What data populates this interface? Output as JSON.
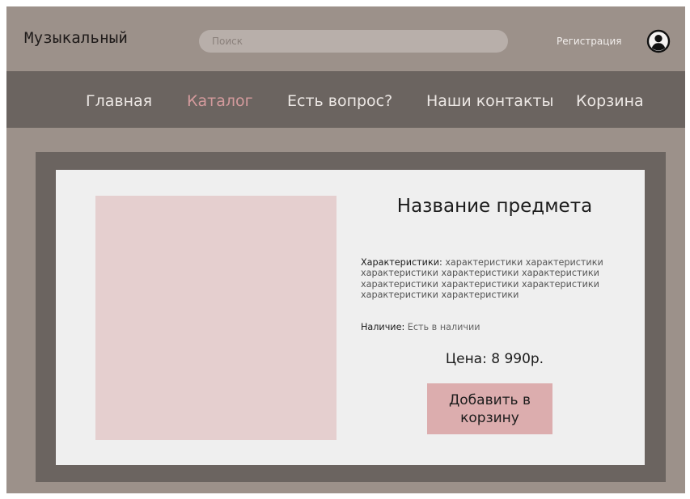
{
  "header": {
    "brand": "Музыкальный",
    "search_placeholder": "Поиск",
    "register_label": "Регистрация",
    "avatar_icon": "user-circle-icon"
  },
  "nav": {
    "items": [
      {
        "label": "Главная",
        "active": false
      },
      {
        "label": "Каталог",
        "active": true
      },
      {
        "label": "Есть вопрос?",
        "active": false
      },
      {
        "label": "Наши контакты",
        "active": false
      },
      {
        "label": "Корзина",
        "active": false
      }
    ]
  },
  "product": {
    "title": "Название предмета",
    "specs_label": "Характеристики:",
    "specs_text": "характеристики характеристики характеристики характеристики характеристики характеристики характеристики характеристики характеристики характеристики",
    "availability_label": "Наличие:",
    "availability_value": "Есть в наличии",
    "price": "Цена: 8 990р.",
    "add_to_cart_label": "Добавить в корзину"
  },
  "colors": {
    "background": "#9c918a",
    "nav_background": "#6b6460",
    "active_nav": "#d39a9c",
    "card": "#efefef",
    "image_placeholder": "#e5cfcf",
    "button": "#dcadae"
  }
}
